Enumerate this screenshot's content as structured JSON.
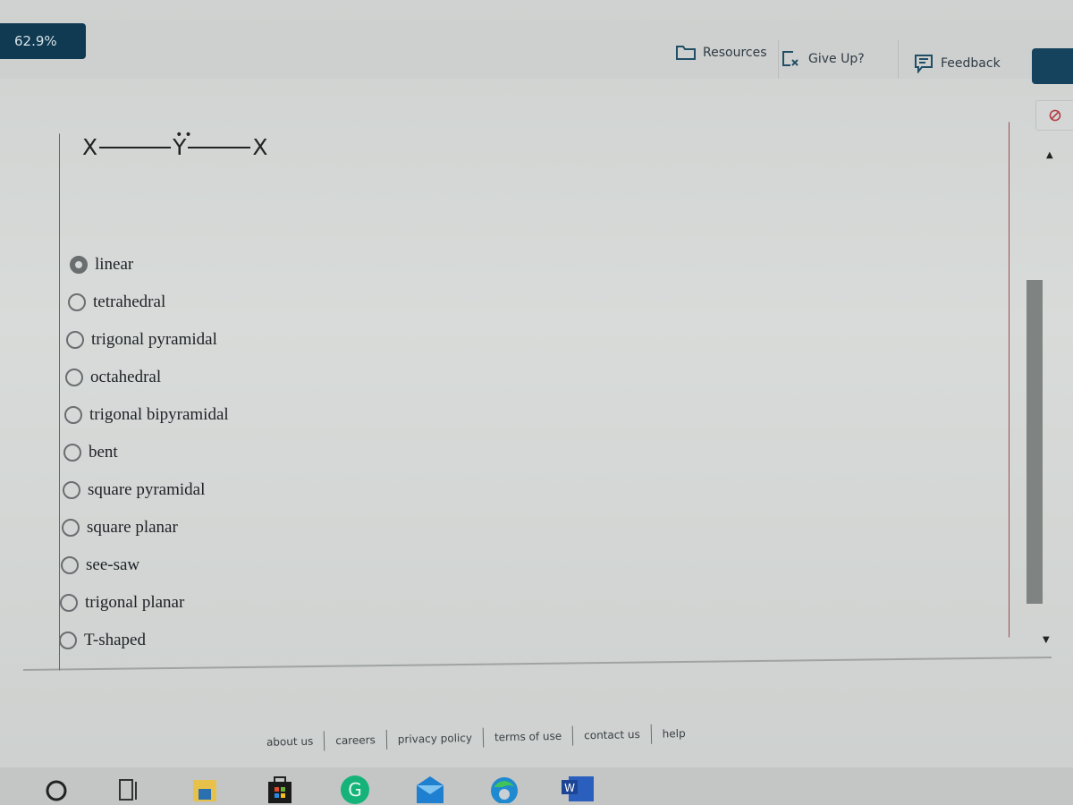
{
  "header": {
    "score": "62.9%",
    "tools": {
      "resources": {
        "label": "Resources",
        "icon": "folder-icon"
      },
      "give_up": {
        "label": "Give Up?",
        "icon": "give-up-icon"
      },
      "feedback": {
        "label": "Feedback",
        "icon": "feedback-icon"
      }
    },
    "block_icon": "no-entry-icon"
  },
  "question": {
    "structure": {
      "left_atom": "X",
      "center_atom": "Y",
      "lone_pair": "••",
      "right_atom": "X"
    },
    "selected_index": 0,
    "options": [
      {
        "label": "linear"
      },
      {
        "label": "tetrahedral"
      },
      {
        "label": "trigonal pyramidal"
      },
      {
        "label": "octahedral"
      },
      {
        "label": "trigonal bipyramidal"
      },
      {
        "label": "bent"
      },
      {
        "label": "square pyramidal"
      },
      {
        "label": "square planar"
      },
      {
        "label": "see-saw"
      },
      {
        "label": "trigonal planar"
      },
      {
        "label": "T-shaped"
      }
    ]
  },
  "footer": {
    "links": [
      "about us",
      "careers",
      "privacy policy",
      "terms of use",
      "contact us",
      "help"
    ]
  },
  "taskbar": {
    "items": [
      "search-icon",
      "task-view-icon",
      "file-explorer-icon",
      "microsoft-store-icon",
      "grammarly-icon",
      "mail-icon",
      "edge-icon",
      "word-icon"
    ],
    "word_label": "W",
    "grammarly_label": "G"
  }
}
